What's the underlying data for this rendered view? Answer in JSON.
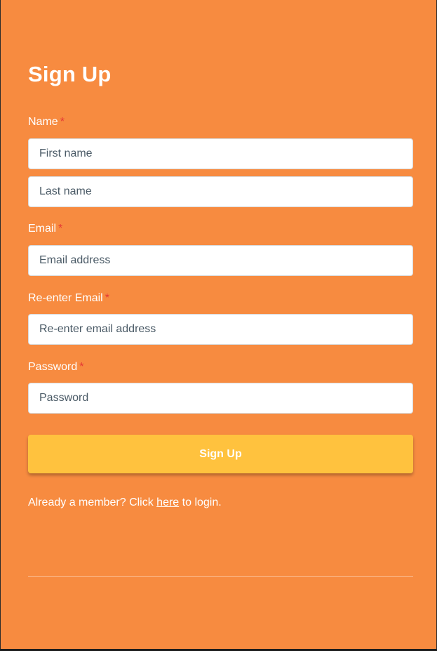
{
  "form": {
    "title": "Sign Up",
    "required_marker": "*",
    "name": {
      "label": "Name",
      "first_placeholder": "First name",
      "last_placeholder": "Last name"
    },
    "email": {
      "label": "Email",
      "placeholder": "Email address"
    },
    "reenter_email": {
      "label": "Re-enter Email",
      "placeholder": "Re-enter email address"
    },
    "password": {
      "label": "Password",
      "placeholder": "Password"
    },
    "submit_label": "Sign Up",
    "login_prompt": {
      "before": "Already a member? Click ",
      "link": "here",
      "after": " to login."
    }
  },
  "colors": {
    "background": "#f78b40",
    "button": "#ffc23e",
    "required": "#e53935",
    "text": "#ffffff"
  }
}
